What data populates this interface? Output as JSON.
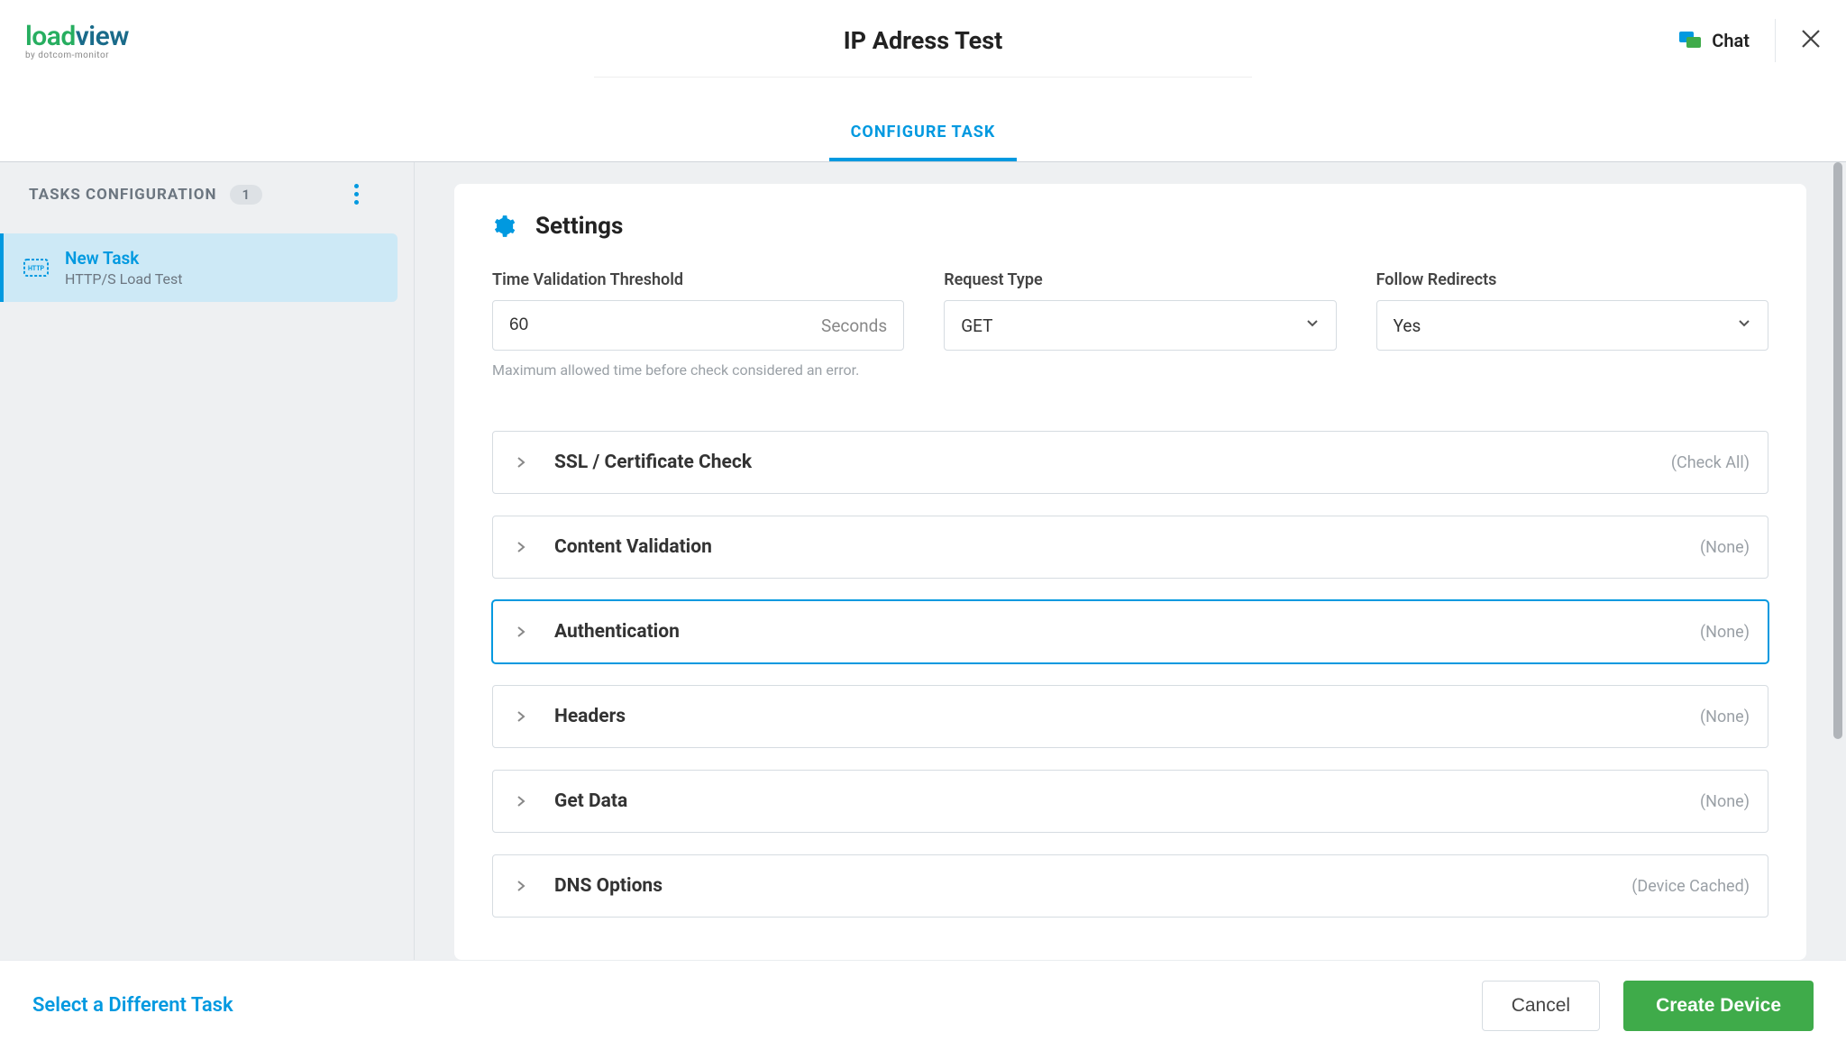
{
  "logo": {
    "brand_a": "load",
    "brand_b": "view",
    "tagline": "by dotcom-monitor"
  },
  "header": {
    "title": "IP Adress Test",
    "chat_label": "Chat"
  },
  "tabs": {
    "configure": "CONFIGURE TASK"
  },
  "sidebar": {
    "header": "TASKS CONFIGURATION",
    "count": "1",
    "task": {
      "title": "New Task",
      "subtitle": "HTTP/S Load Test"
    }
  },
  "settings": {
    "title": "Settings",
    "threshold": {
      "label": "Time Validation Threshold",
      "value": "60",
      "unit": "Seconds",
      "help": "Maximum allowed time before check considered an error."
    },
    "request_type": {
      "label": "Request Type",
      "value": "GET"
    },
    "follow_redirects": {
      "label": "Follow Redirects",
      "value": "Yes"
    }
  },
  "accordion": {
    "ssl": {
      "title": "SSL / Certificate Check",
      "summary": "(Check All)"
    },
    "content": {
      "title": "Content Validation",
      "summary": "(None)"
    },
    "auth": {
      "title": "Authentication",
      "summary": "(None)"
    },
    "headers": {
      "title": "Headers",
      "summary": "(None)"
    },
    "get_data": {
      "title": "Get Data",
      "summary": "(None)"
    },
    "dns": {
      "title": "DNS Options",
      "summary": "(Device Cached)"
    }
  },
  "footer": {
    "select_task": "Select a Different Task",
    "cancel": "Cancel",
    "create": "Create Device"
  }
}
